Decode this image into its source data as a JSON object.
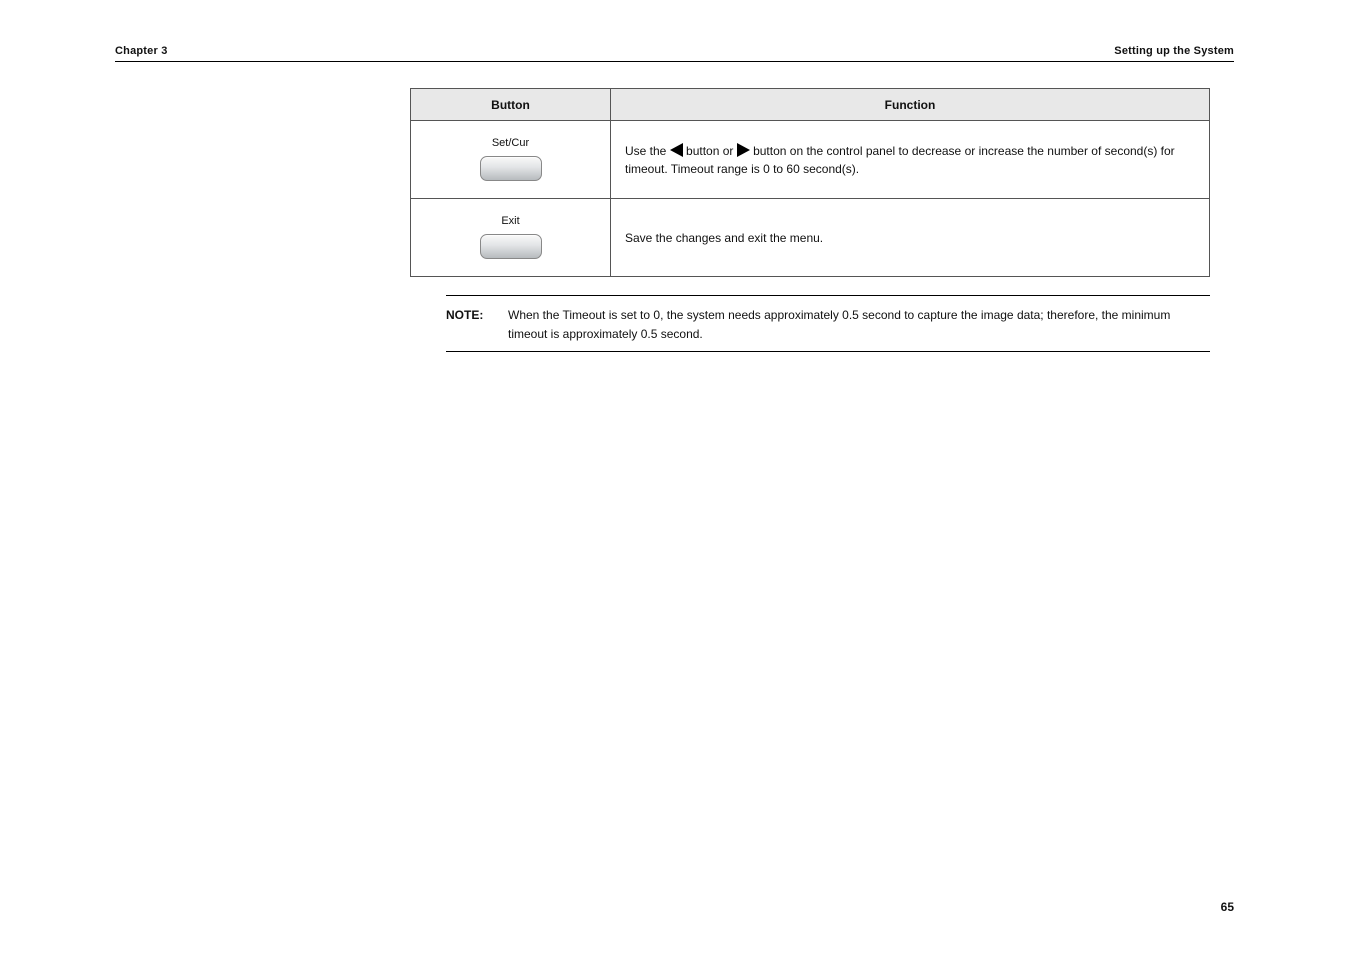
{
  "header": {
    "chapter": "Chapter 3",
    "section": "Setting up the System"
  },
  "table": {
    "col1": "Button",
    "col2": "Function",
    "rows": [
      {
        "label": "Set/Cur",
        "desc_pre": "Use the ",
        "desc_mid": " button or ",
        "desc_post": " button on the control panel to decrease or increase the number of second(s) for timeout. Timeout range is 0 to 60 second(s)."
      },
      {
        "label": "Exit",
        "desc": "Save the changes and exit the menu."
      }
    ]
  },
  "note": {
    "label": "NOTE:",
    "text": "When the Timeout is set to 0, the system needs approximately 0.5 second to capture the image data; therefore, the minimum timeout is approximately 0.5 second."
  },
  "page_number": "65"
}
